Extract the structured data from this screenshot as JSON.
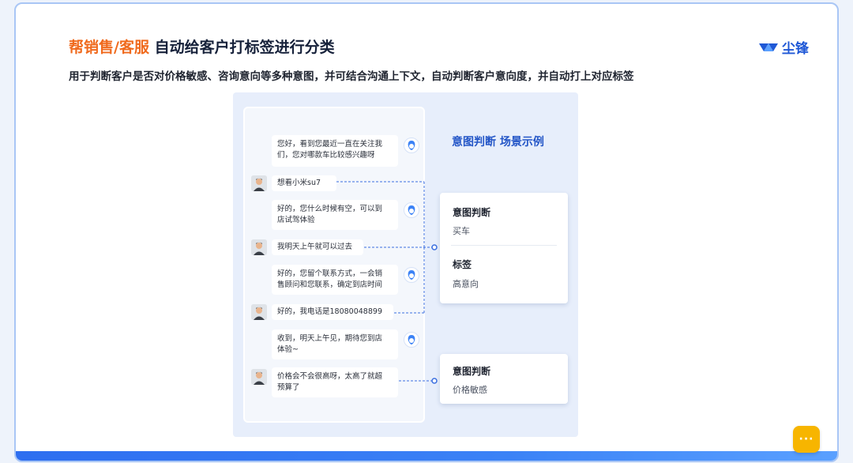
{
  "header": {
    "title_accent": "帮销售/客服",
    "title_rest": "自动给客户打标签进行分类",
    "subtitle": "用于判断客户是否对价格敏感、咨询意向等多种意图，并可结合沟通上下文，自动判断客户意向度，并自动打上对应标签",
    "logo_text": "尘锋"
  },
  "panel": {
    "scene_title": "意图判断 场景示例"
  },
  "chat": {
    "messages": [
      {
        "role": "bot",
        "line1": "您好，看到您最近一直在关注我",
        "line2": "们，您对哪款车比较感兴趣呀"
      },
      {
        "role": "user",
        "line1": "想看小米su7"
      },
      {
        "role": "bot",
        "line1": "好的，您什么时候有空，可以到",
        "line2": "店试驾体验"
      },
      {
        "role": "user",
        "line1": "我明天上午就可以过去"
      },
      {
        "role": "bot",
        "line1": "好的，您留个联系方式，一会销",
        "line2": "售顾问和您联系，确定到店时间"
      },
      {
        "role": "user",
        "line1": "好的，我电话是18080048899"
      },
      {
        "role": "bot",
        "line1": "收到，明天上午见，期待您到店",
        "line2": "体验~"
      },
      {
        "role": "user",
        "line1": "价格会不会很高呀，太高了就超",
        "line2": "预算了"
      }
    ]
  },
  "cards": {
    "card1": {
      "label1": "意图判断",
      "value1": "买车",
      "label2": "标签",
      "value2": "高意向"
    },
    "card2": {
      "label1": "意图判断",
      "value1": "价格敏感"
    }
  },
  "help": {
    "icon": "chat-bubble-icon",
    "glyph": "···"
  },
  "colors": {
    "accent": "#f06a1d",
    "brand": "#1f58d6",
    "link": "#3b6fe0"
  }
}
